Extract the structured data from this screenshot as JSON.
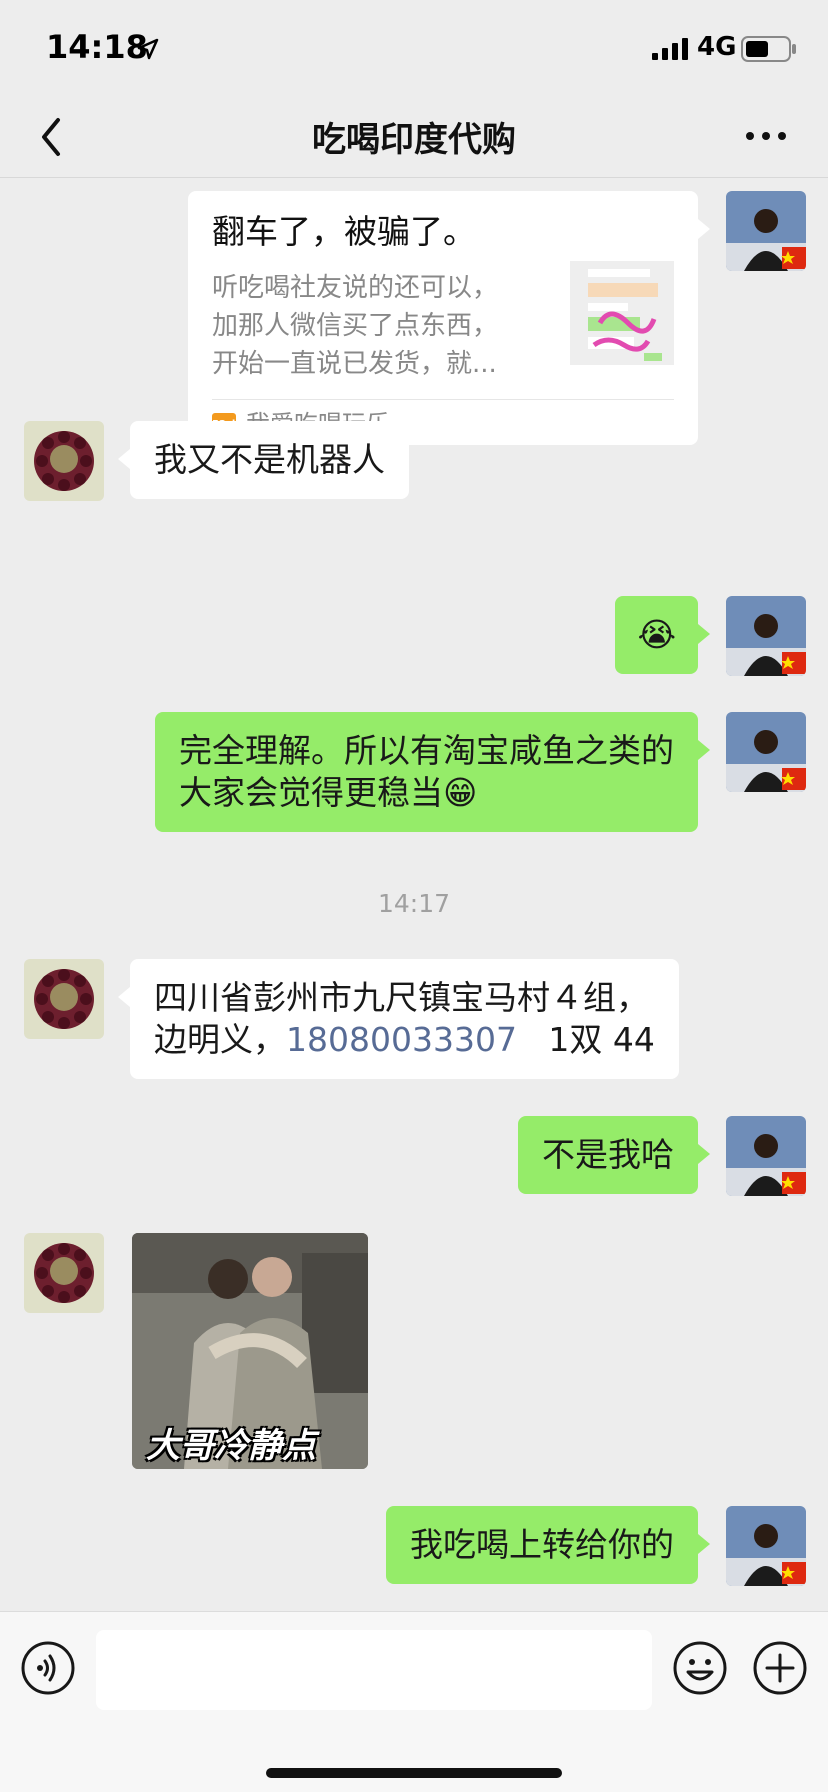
{
  "status_bar": {
    "time": "14:18",
    "network": "4G"
  },
  "header": {
    "title": "吃喝印度代购"
  },
  "messages": {
    "card": {
      "title": "翻车了，被骗了。",
      "desc_line1": "听吃喝社友说的还可以，",
      "desc_line2": "加那人微信买了点东西，",
      "desc_line3": "开始一直说已发货，就...",
      "source_icon": "52ch",
      "source": "我爱吃喝玩乐"
    },
    "m1": {
      "text": "我又不是机器人"
    },
    "m2": {
      "text": "😭"
    },
    "m3": {
      "line1": "完全理解。所以有淘宝咸鱼之类的",
      "line2": "大家会觉得更稳当😁"
    },
    "timestamp": "14:17",
    "m4": {
      "line1": "四川省彭州市九尺镇宝马村４组，",
      "line2_prefix": "边明义，",
      "phone": "18080033307",
      "line2_suffix": "   1双 44"
    },
    "m5": {
      "text": "不是我哈"
    },
    "sticker": {
      "caption": "大哥冷静点"
    },
    "m6": {
      "text": "我吃喝上转给你的"
    }
  },
  "input": {
    "placeholder": ""
  }
}
